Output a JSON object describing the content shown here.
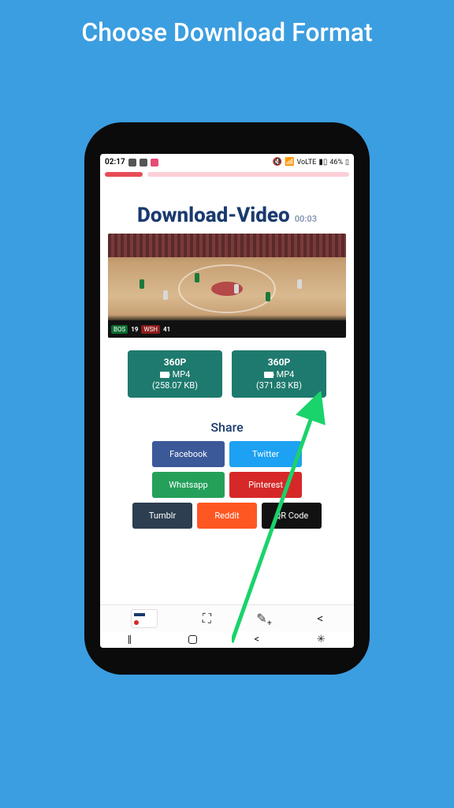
{
  "page": {
    "title": "Choose Download Format"
  },
  "status": {
    "time": "02:17",
    "battery": "46%",
    "net_label": "VoLTE"
  },
  "download": {
    "title": "Download-Video",
    "duration": "00:03"
  },
  "scoreboard": {
    "team1_abbr": "BOS",
    "team1_score": "19",
    "team2_abbr": "WSH",
    "team2_score": "41"
  },
  "formats": [
    {
      "resolution": "360P",
      "type": "MP4",
      "size": "(258.07 KB)"
    },
    {
      "resolution": "360P",
      "type": "MP4",
      "size": "(371.83 KB)"
    }
  ],
  "share": {
    "label": "Share",
    "row1": [
      {
        "name": "Facebook",
        "class": "fb"
      },
      {
        "name": "Twitter",
        "class": "tw"
      }
    ],
    "row2": [
      {
        "name": "Whatsapp",
        "class": "wa"
      },
      {
        "name": "Pinterest",
        "class": "pin"
      }
    ],
    "row3": [
      {
        "name": "Tumblr",
        "class": "tum"
      },
      {
        "name": "Reddit",
        "class": "red"
      },
      {
        "name": "QR Code",
        "class": "qr"
      }
    ]
  }
}
